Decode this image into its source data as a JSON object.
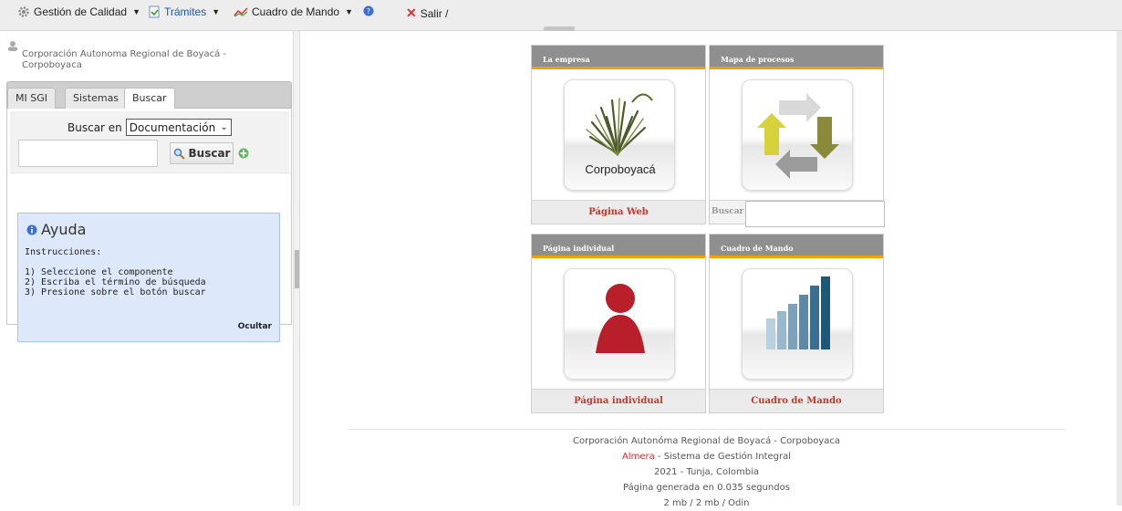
{
  "toolbar": {
    "gestion": "Gestión de Calidad",
    "tramites": "Trámites",
    "cuadro": "Cuadro de Mando",
    "salir": "Salir /"
  },
  "user": {
    "org": "Corporación Autonoma Regional de Boyacá -",
    "org2": "Corpoboyaca"
  },
  "tabs": [
    "MI SGI",
    "Sistemas",
    "Buscar"
  ],
  "search": {
    "label": "Buscar en",
    "selected": "Documentación",
    "button": "Buscar"
  },
  "help": {
    "title": "Ayuda",
    "instrucciones": "Instrucciones:",
    "step1": "1) Seleccione el componente",
    "step2": "2) Escriba el término de búsqueda",
    "step3": "3) Presione sobre el botón buscar",
    "hide": "Ocultar"
  },
  "tiles": {
    "empresa": {
      "title": "La empresa",
      "logo_text": "Corpoboyacá",
      "link": "Página Web"
    },
    "mapa": {
      "title": "Mapa de procesos",
      "search_label": "Buscar"
    },
    "individual": {
      "title": "Página individual",
      "link": "Página individual"
    },
    "cuadro": {
      "title": "Cuadro de Mando",
      "link": "Cuadro de Mando"
    }
  },
  "footer": {
    "line1": "Corporación Autonóma Regional de Boyacá - Corpoboyaca",
    "brand": "Almera",
    "line2_rest": " - Sistema de Gestión Integral",
    "line3": "2021 - Tunja, Colombia",
    "line4": "Página generada en 0.035 segundos",
    "line5": "2 mb / 2 mb / Odin"
  },
  "colors": {
    "accent": "#f0a000",
    "link": "#c0392b",
    "help_bg": "#dde9fb"
  }
}
